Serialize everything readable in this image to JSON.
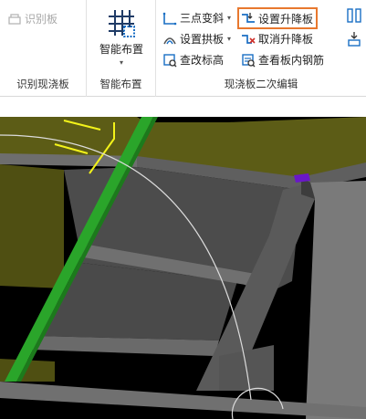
{
  "ribbon": {
    "groups": [
      {
        "label": "识别现浇板",
        "buttons": [
          {
            "label": "识别板",
            "icon": "recognize-slab-icon",
            "enabled": false
          }
        ]
      },
      {
        "label": "智能布置",
        "buttons": [
          {
            "label": "智能布置",
            "icon": "grid-layout-icon",
            "has_dropdown": true
          }
        ]
      },
      {
        "label": "现浇板二次编辑",
        "buttons": [
          {
            "label": "三点变斜",
            "icon": "three-point-slope-icon",
            "has_dropdown": true
          },
          {
            "label": "设置拱板",
            "icon": "arch-slab-icon",
            "has_dropdown": true
          },
          {
            "label": "查改标高",
            "icon": "elevation-icon"
          },
          {
            "label": "设置升降板",
            "icon": "raise-lower-slab-icon",
            "highlighted": true
          },
          {
            "label": "取消升降板",
            "icon": "cancel-raise-lower-icon"
          },
          {
            "label": "查看板内钢筋",
            "icon": "view-rebar-icon"
          }
        ],
        "side_icons": [
          "split-slab-icon",
          "align-slab-icon"
        ]
      }
    ]
  },
  "colors": {
    "highlight_border": "#e8782e",
    "accent_blue": "#1a6fc4",
    "slab_olive": "#5c5c16",
    "beam_green": "#2aa52a",
    "beam_gray": "#6a6a6a",
    "viewport_bg": "#000000"
  }
}
